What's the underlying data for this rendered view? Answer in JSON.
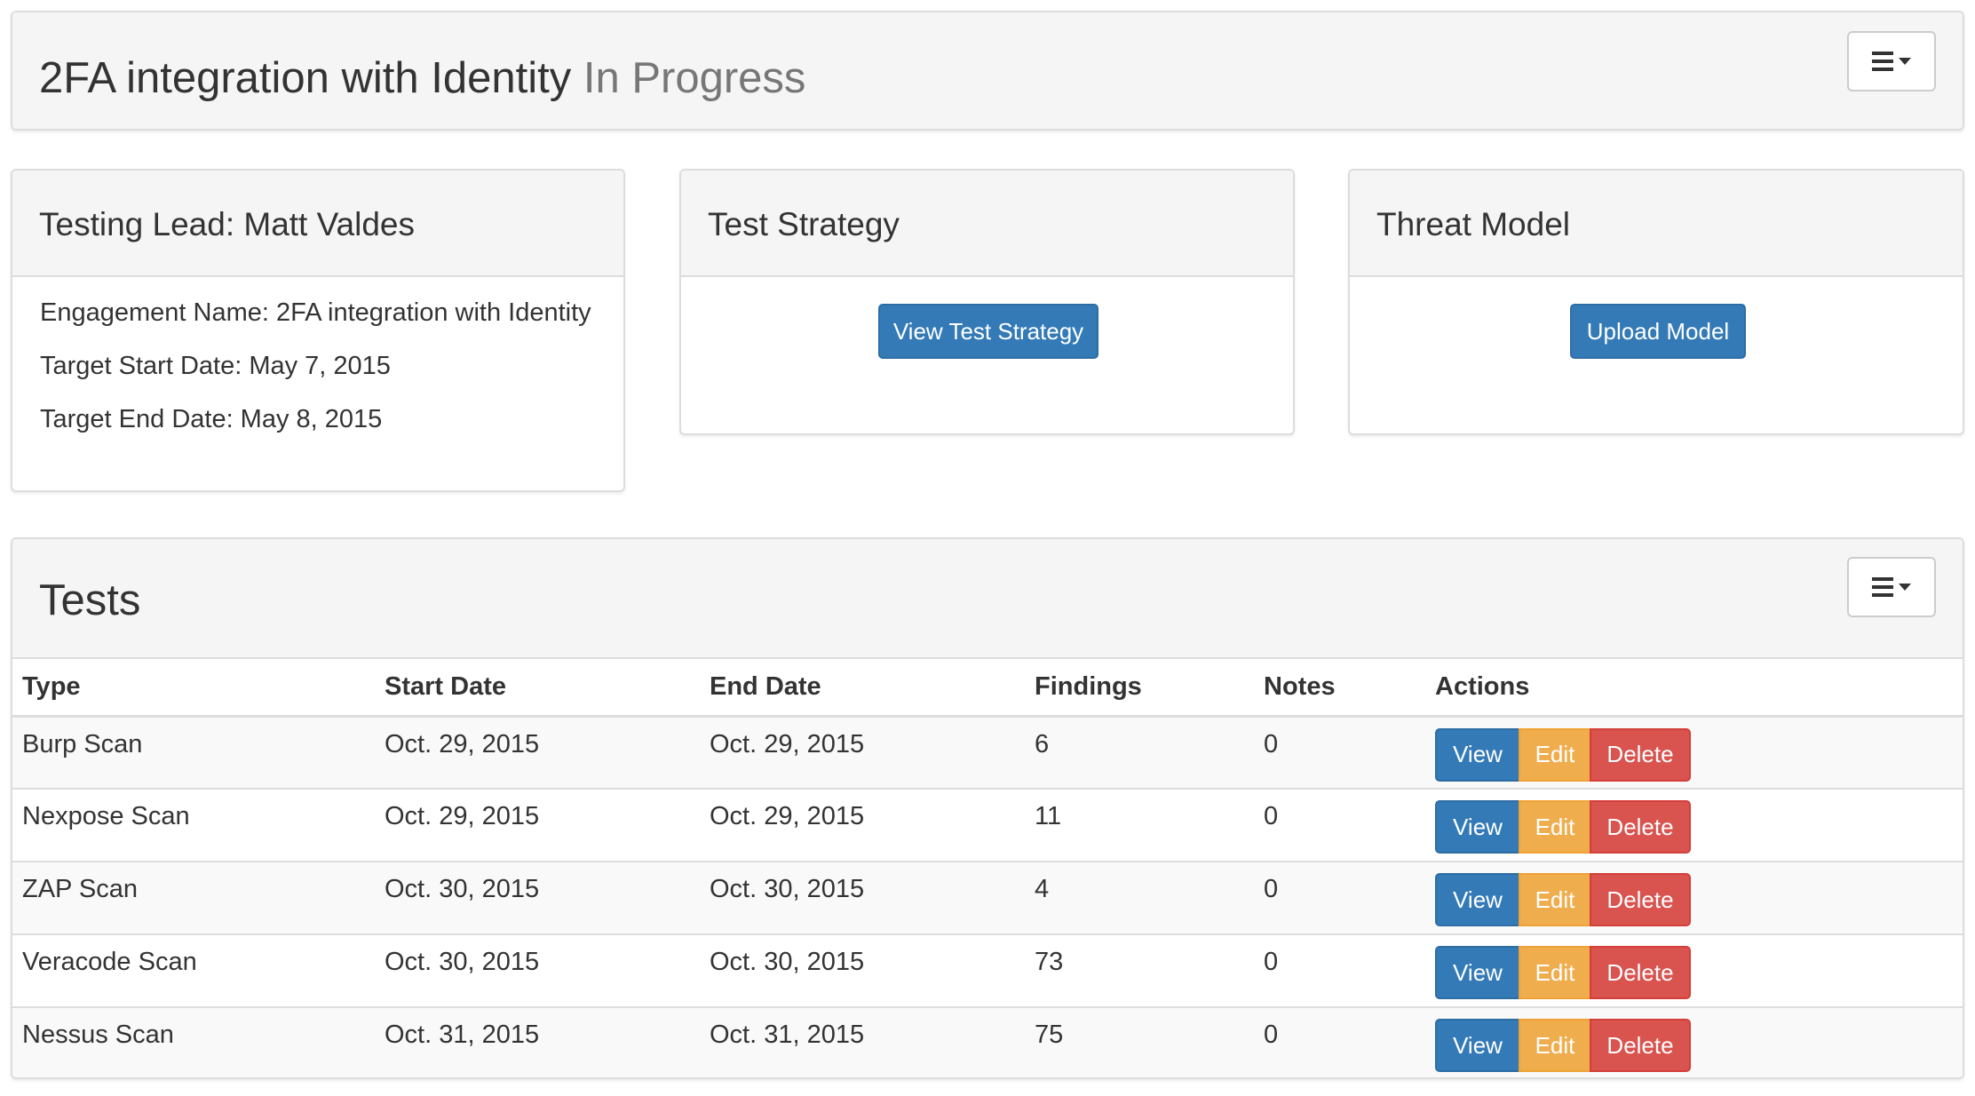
{
  "header": {
    "title": "2FA integration with Identity",
    "status": "In Progress",
    "menu_icon": "hamburger-icon"
  },
  "lead_card": {
    "heading": "Testing Lead: Matt Valdes",
    "engagement_name": "Engagement Name: 2FA integration with Identity",
    "target_start": "Target Start Date: May 7, 2015",
    "target_end": "Target End Date: May 8, 2015"
  },
  "strategy_card": {
    "heading": "Test Strategy",
    "button_label": "View Test Strategy"
  },
  "threat_card": {
    "heading": "Threat Model",
    "button_label": "Upload Model"
  },
  "tests": {
    "title": "Tests",
    "columns": [
      "Type",
      "Start Date",
      "End Date",
      "Findings",
      "Notes",
      "Actions"
    ],
    "action_labels": {
      "view": "View",
      "edit": "Edit",
      "delete": "Delete"
    },
    "rows": [
      {
        "type": "Burp Scan",
        "start": "Oct. 29, 2015",
        "end": "Oct. 29, 2015",
        "findings": "6",
        "notes": "0"
      },
      {
        "type": "Nexpose Scan",
        "start": "Oct. 29, 2015",
        "end": "Oct. 29, 2015",
        "findings": "11",
        "notes": "0"
      },
      {
        "type": "ZAP Scan",
        "start": "Oct. 30, 2015",
        "end": "Oct. 30, 2015",
        "findings": "4",
        "notes": "0"
      },
      {
        "type": "Veracode Scan",
        "start": "Oct. 30, 2015",
        "end": "Oct. 30, 2015",
        "findings": "73",
        "notes": "0"
      },
      {
        "type": "Nessus Scan",
        "start": "Oct. 31, 2015",
        "end": "Oct. 31, 2015",
        "findings": "75",
        "notes": "0"
      }
    ]
  },
  "colors": {
    "primary": "#337ab7",
    "warning": "#f0ad4e",
    "danger": "#d9534f",
    "panel_heading_bg": "#f5f5f5",
    "status_text": "#777777"
  }
}
